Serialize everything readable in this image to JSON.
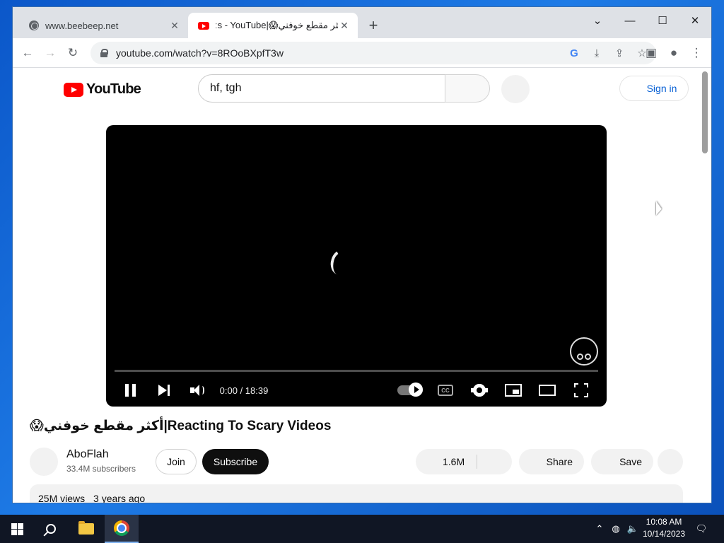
{
  "browser": {
    "tabs": [
      {
        "title": "www.beebeep.net",
        "close": "✕"
      },
      {
        "title": "ːs - YouTube|😱أكثر مقطع خوفني",
        "close": "✕"
      }
    ],
    "new_tab": "+",
    "url": "youtube.com/watch?v=8ROoBXpfT3w"
  },
  "youtube": {
    "logo_text": "YouTube",
    "search_value": "hf, tgh",
    "sign_in": "Sign in",
    "player": {
      "time": "0:00 / 18:39",
      "cc_label": "CC"
    },
    "video": {
      "title": "😱أكثر مقطع خوفني|Reacting To Scary Videos",
      "channel": "AboFlah",
      "subscribers": "33.4M subscribers",
      "join": "Join",
      "subscribe": "Subscribe",
      "likes": "1.6M",
      "share": "Share",
      "save": "Save",
      "views": "25M views",
      "age": "3 years ago"
    }
  },
  "taskbar": {
    "time": "10:08 AM",
    "date": "10/14/2023"
  },
  "colors": {
    "youtube_red": "#ff0000",
    "link_blue": "#065fd4",
    "taskbar": "#101624"
  }
}
